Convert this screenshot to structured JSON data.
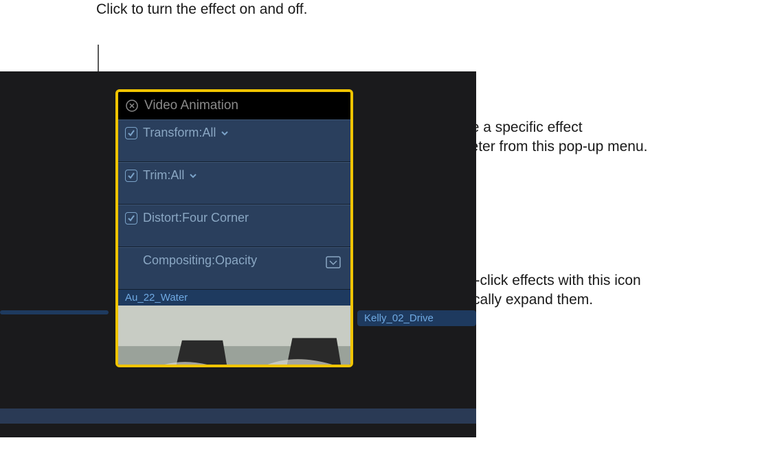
{
  "callouts": {
    "top": "Click to turn the effect on and off.",
    "right_top": "Choose a specific effect parameter from this pop-up menu.",
    "right_bottom": "Double-click effects with this icon to vertically expand them."
  },
  "panel": {
    "title": "Video Animation",
    "rows": [
      {
        "checked": true,
        "label": "Transform:All",
        "has_menu": true,
        "has_expand": false
      },
      {
        "checked": true,
        "label": "Trim:All",
        "has_menu": true,
        "has_expand": false
      },
      {
        "checked": true,
        "label": "Distort:Four Corner",
        "has_menu": false,
        "has_expand": false
      },
      {
        "checked": false,
        "label": "Compositing:Opacity",
        "has_menu": false,
        "has_expand": true
      }
    ]
  },
  "clips": {
    "left_clip_label": "",
    "center_clip_label": "Au_22_Water",
    "right_clip_label": "Kelly_02_Drive"
  }
}
